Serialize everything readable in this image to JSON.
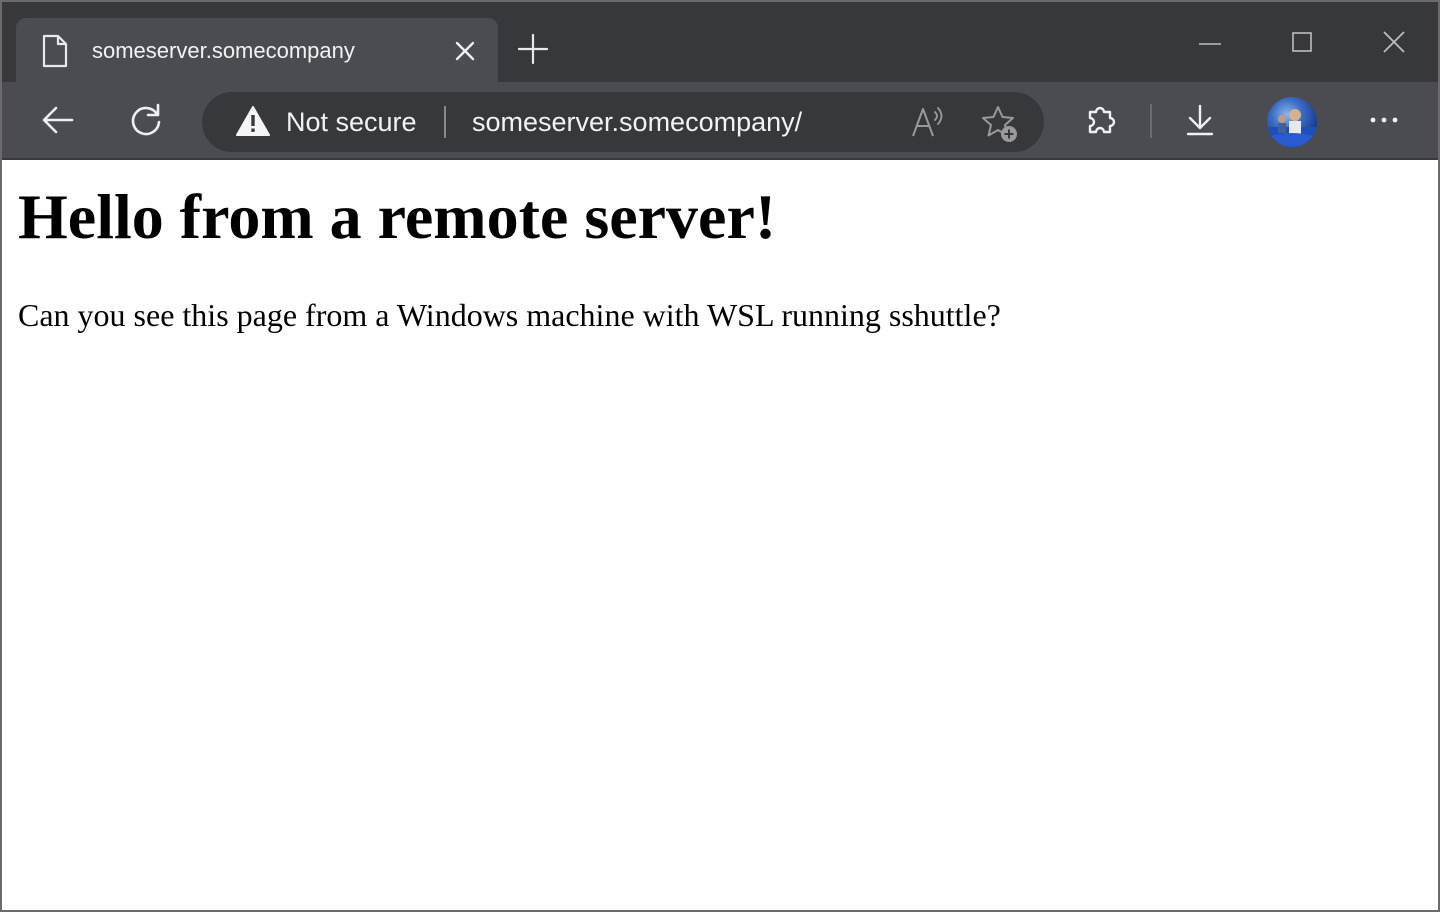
{
  "tab": {
    "title": "someserver.somecompany"
  },
  "omnibox": {
    "security_label": "Not secure",
    "url": "someserver.somecompany/"
  },
  "page": {
    "heading": "Hello from a remote server!",
    "paragraph": "Can you see this page from a Windows machine with WSL running sshuttle?"
  },
  "icons": {
    "tab_favicon": "page-icon",
    "tab_close": "close-icon",
    "new_tab": "plus-icon",
    "back": "arrow-left-icon",
    "reload": "refresh-icon",
    "security_warning": "warning-icon",
    "read_aloud": "read-aloud-icon",
    "favorite": "star-add-icon",
    "extensions": "puzzle-icon",
    "downloads": "download-icon",
    "profile": "avatar",
    "menu": "more-icon"
  },
  "colors": {
    "titlebar_bg": "#36383c",
    "toolbar_bg": "#4a4c51",
    "omnibox_bg": "#36383c",
    "text_light": "#f2f2f2",
    "page_bg": "#ffffff"
  }
}
